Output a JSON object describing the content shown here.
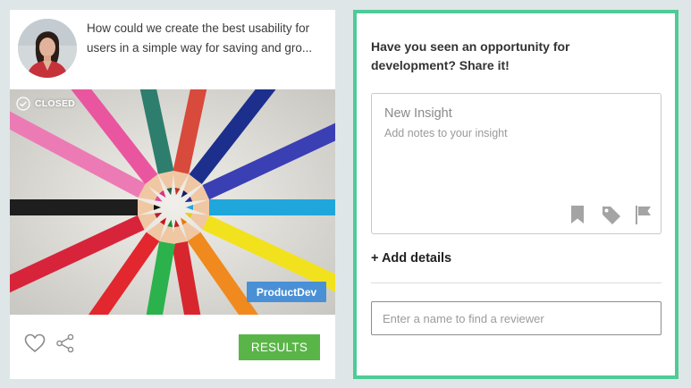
{
  "card": {
    "question_line1": "How could we create the best usability for",
    "question_line2": "users in a simple way for saving and gro...",
    "status_label": "CLOSED",
    "tag_label": "ProductDev",
    "results_label": "RESULTS"
  },
  "panel": {
    "prompt_line1": "Have you seen an opportunity for",
    "prompt_line2": "development? Share it!",
    "insight_title": "New Insight",
    "insight_notes": "Add notes to your insight",
    "add_details_label": "+ Add details",
    "reviewer_placeholder": "Enter a name to find a reviewer"
  },
  "colors": {
    "accent_border": "#4ecb97",
    "results_green": "#5ab548",
    "tag_blue": "#4a90d6",
    "background": "#dfe6e7"
  },
  "icons": {
    "status": "check-circle-icon",
    "like": "heart-icon",
    "share": "share-icon",
    "bookmark": "bookmark-icon",
    "tag": "tag-icon",
    "flag": "flag-icon"
  }
}
